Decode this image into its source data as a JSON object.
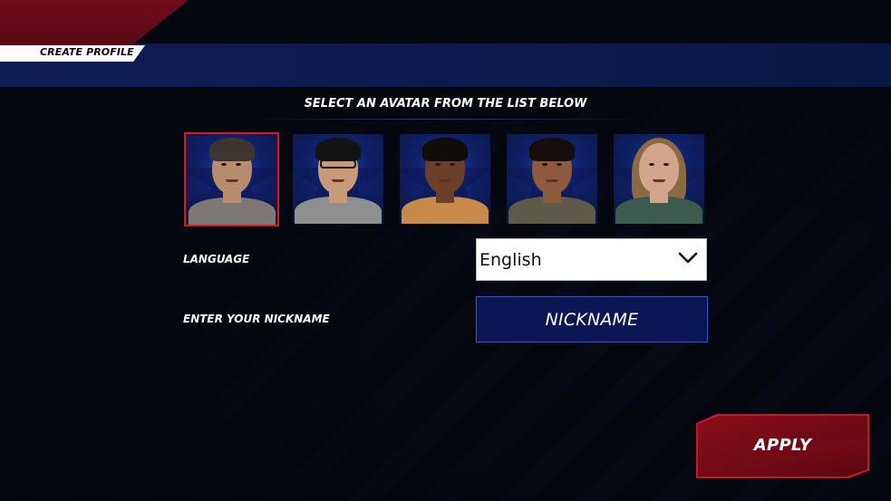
{
  "header": {
    "title": "CREATE PROFILE"
  },
  "avatar_picker": {
    "prompt": "SELECT AN AVATAR FROM THE LIST BELOW",
    "selected_index": 0,
    "avatars": [
      {
        "name": "avatar-1",
        "skin": "#b98c6e",
        "hair": "#3d3530",
        "shirt": "#7d7874"
      },
      {
        "name": "avatar-2",
        "skin": "#c99a78",
        "hair": "#141414",
        "shirt": "#8e9090",
        "glasses": true
      },
      {
        "name": "avatar-3",
        "skin": "#6b3f28",
        "hair": "#120c08",
        "shirt": "#c8894a"
      },
      {
        "name": "avatar-4",
        "skin": "#8d5a3c",
        "hair": "#150e0a",
        "shirt": "#5e5a48"
      },
      {
        "name": "avatar-5",
        "skin": "#d2a58c",
        "hair": "#8a6a3e",
        "shirt": "#3c5a4e",
        "long_hair": true
      }
    ]
  },
  "language": {
    "label": "LANGUAGE",
    "value": "English"
  },
  "nickname": {
    "label": "ENTER YOUR NICKNAME",
    "placeholder": "NICKNAME"
  },
  "apply": {
    "label": "APPLY"
  },
  "colors": {
    "header_blue": "#0f1d55",
    "header_red": "#6d0d18",
    "selection_red": "#e0141e",
    "apply_red": "#8a0f1b",
    "field_blue": "#0b1754",
    "field_border": "#3a56d8"
  }
}
